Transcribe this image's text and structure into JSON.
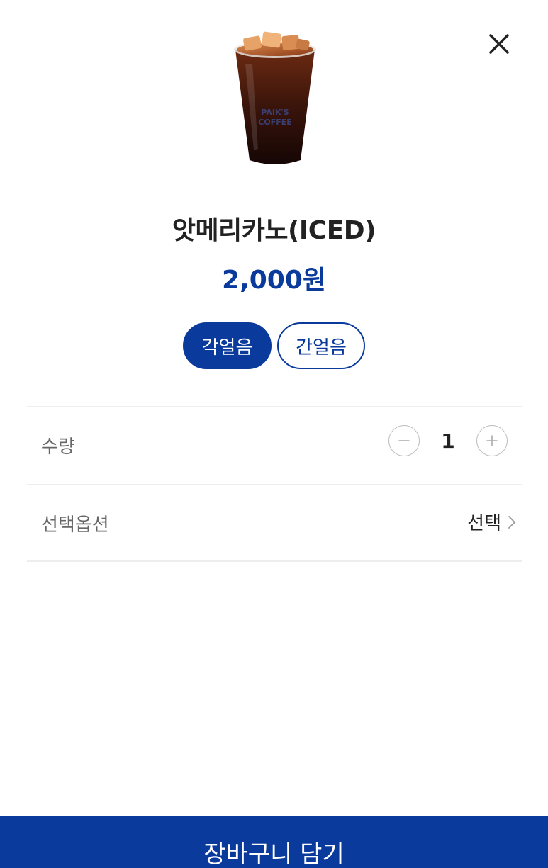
{
  "product": {
    "name": "앗메리카노(ICED)",
    "price": "2,000원",
    "image_alt": "iced americano cup"
  },
  "ice_options": [
    {
      "label": "각얼음",
      "selected": true
    },
    {
      "label": "간얼음",
      "selected": false
    }
  ],
  "quantity": {
    "label": "수량",
    "value": "1"
  },
  "option": {
    "label": "선택옵션",
    "select_label": "선택"
  },
  "cart_button": {
    "label": "장바구니 담기"
  },
  "colors": {
    "accent": "#0a3b9c",
    "text": "#222222",
    "muted": "#666666",
    "divider": "#eeeeee"
  },
  "icons": {
    "close": "close-icon",
    "minus": "minus-icon",
    "plus": "plus-icon",
    "chevron": "chevron-right-icon"
  }
}
